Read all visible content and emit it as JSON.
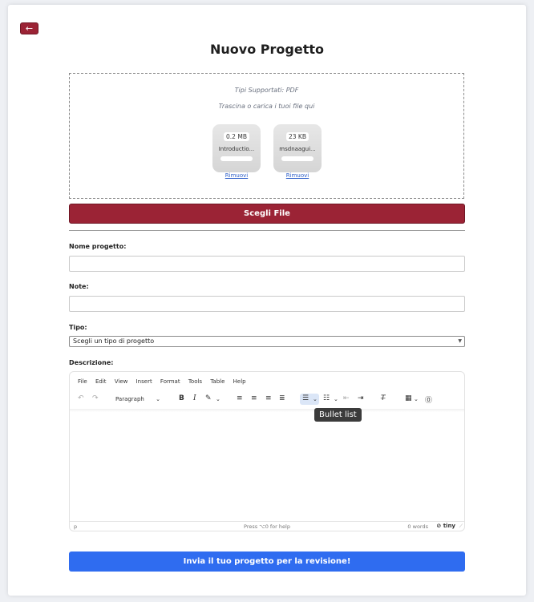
{
  "back_button": {
    "label": "←"
  },
  "title": "Nuovo Progetto",
  "upload": {
    "supported_types": "Tipi Supportati: PDF",
    "drag_hint": "Trascina o carica i tuoi file qui",
    "files": [
      {
        "size": "0.2 MB",
        "name": "Introductio...",
        "remove_label": "Rimuovi"
      },
      {
        "size": "23 KB",
        "name": "msdnaagui...",
        "remove_label": "Rimuovi"
      }
    ],
    "choose_button": "Scegli File"
  },
  "form": {
    "name_label": "Nome progetto:",
    "name_value": "",
    "notes_label": "Note:",
    "notes_value": "",
    "type_label": "Tipo:",
    "type_selected": "Scegli un tipo di progetto",
    "description_label": "Descrizione:"
  },
  "editor": {
    "menu": [
      "File",
      "Edit",
      "View",
      "Insert",
      "Format",
      "Tools",
      "Table",
      "Help"
    ],
    "block_format": "Paragraph",
    "tooltip": "Bullet list",
    "status_path": "p",
    "status_help": "Press ⌥0 for help",
    "status_words": "0 words",
    "brand": "tiny"
  },
  "submit_button": "Invia il tuo progetto per la revisione!"
}
